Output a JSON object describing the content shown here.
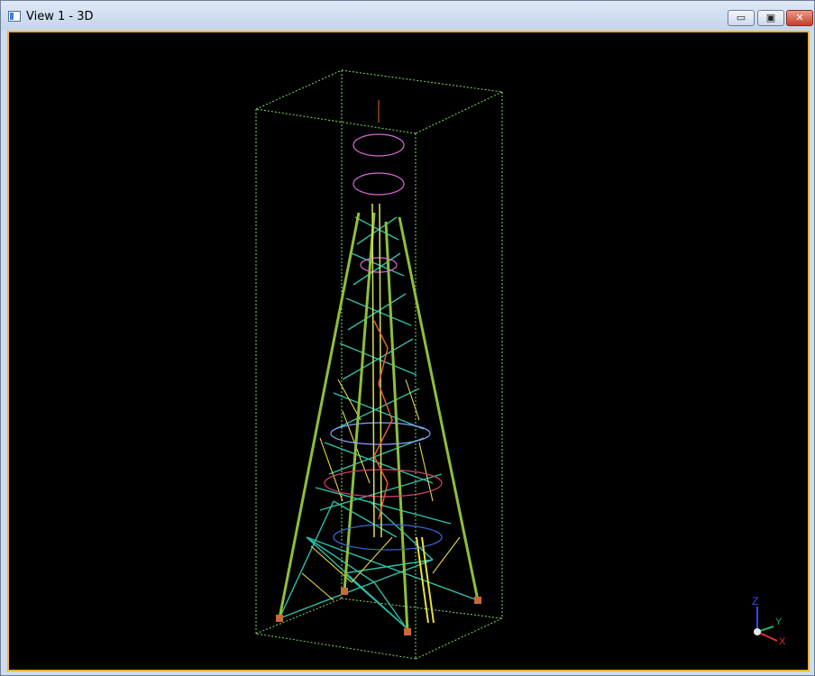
{
  "window": {
    "title": "View 1 - 3D",
    "minimize_glyph": "▭",
    "maximize_glyph": "▣",
    "close_glyph": "✕"
  },
  "viewport": {
    "background": "#000000",
    "border_color": "#f2b233",
    "model": "lattice-tower-3d"
  },
  "axis_triad": {
    "labels": [
      "Z",
      "Y",
      "X"
    ],
    "colors": {
      "z": "#2a4cff",
      "y": "#1db35a",
      "x": "#e03030"
    }
  },
  "colors": {
    "legs": "#8fbf3a",
    "bracing": "#2fbfa8",
    "secondary": "#e8d84a",
    "platforms": "#c85ad8",
    "stair": "#e06030",
    "bounding_box": "#7ddc6a"
  }
}
